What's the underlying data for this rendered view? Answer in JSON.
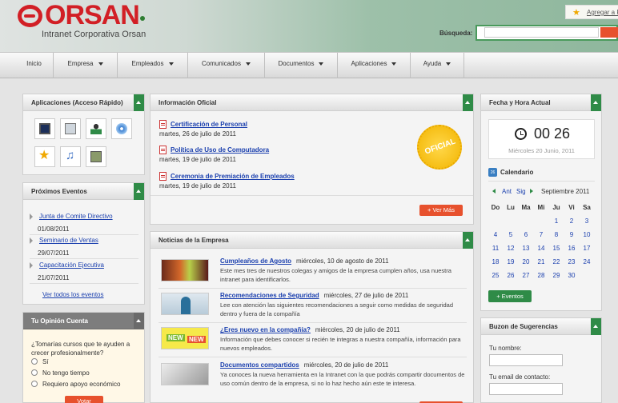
{
  "header": {
    "logo_text": "ORSAN",
    "subtitle": "Intranet Corporativa Orsan",
    "favorites_link": "Agregar a F",
    "search_label": "Búsqueda:",
    "search_value": ""
  },
  "nav": {
    "items": [
      {
        "label": "Inicio",
        "dropdown": false
      },
      {
        "label": "Empresa",
        "dropdown": true
      },
      {
        "label": "Empleados",
        "dropdown": true
      },
      {
        "label": "Comunicados",
        "dropdown": true
      },
      {
        "label": "Documentos",
        "dropdown": true
      },
      {
        "label": "Aplicaciones",
        "dropdown": true
      },
      {
        "label": "Ayuda",
        "dropdown": true
      }
    ]
  },
  "apps": {
    "title": "Aplicaciones (Acceso Rápido)",
    "icons": [
      "monitor-icon",
      "calculator-icon",
      "user-icon",
      "disc-icon",
      "star-icon",
      "music-icon",
      "book-icon"
    ]
  },
  "events": {
    "title": "Próximos Eventos",
    "items": [
      {
        "title": "Junta de Comite Directivo",
        "date": "01/08/2011"
      },
      {
        "title": "Seminario de Ventas",
        "date": "29/07/2011"
      },
      {
        "title": "Capacitación Ejecutiva",
        "date": "21/07/2011"
      }
    ],
    "all_link": "Ver todos los eventos"
  },
  "survey": {
    "title": "Tu Opinión Cuenta",
    "question": "¿Tomarías cursos que te ayuden a crecer profesionalmente?",
    "options": [
      "Sí",
      "No tengo tiempo",
      "Requiero apoyo económico"
    ],
    "button": "Votar"
  },
  "official": {
    "title": "Información Oficial",
    "items": [
      {
        "title": "Certificación de Personal",
        "date": "martes, 26 de julio de 2011"
      },
      {
        "title": "Política de Uso de Computadora",
        "date": "martes, 19 de julio de 2011"
      },
      {
        "title": "Ceremonia de Premiación de Empleados",
        "date": "martes, 19 de julio de 2011"
      }
    ],
    "badge": "OFICIAL",
    "more": "+ Ver Más"
  },
  "news": {
    "title": "Noticias de la Empresa",
    "items": [
      {
        "title": "Cumpleaños de Agosto",
        "date": "miércoles, 10 de agosto de 2011",
        "body": "Este mes tres de nuestros colegas y amigos de la empresa cumplen años, usa nuestra intranet para identificarlos."
      },
      {
        "title": "Recomendaciones de Seguridad",
        "date": "miércoles, 27 de julio de 2011",
        "body": "Lee con atención las siguientes recomendaciones a seguir como medidas de seguridad dentro y fuera de la compañía"
      },
      {
        "title": "¿Eres nuevo en la compañía?",
        "date": "miércoles, 20 de julio de 2011",
        "body": "Información que debes conocer si recién te integras a nuestra compañía, información para nuevos empleados.",
        "thumb_text": "NEW"
      },
      {
        "title": "Documentos compartidos",
        "date": "miércoles, 20 de julio de 2011",
        "body": "Ya conoces la nueva herramienta en la Intranet con la que podrás compartir documentos de uso común dentro de la empresa, si no lo haz hecho aún este te interesa."
      }
    ]
  },
  "datetime": {
    "title": "Fecha y Hora Actual",
    "time": "00 26",
    "date": "Miércoles 20 Junio, 2011"
  },
  "calendar": {
    "label": "Calendario",
    "icon_day": "26",
    "prev": "Ant",
    "next": "Sig",
    "month": "Septiembre 2011",
    "days": [
      "Do",
      "Lu",
      "Ma",
      "Mi",
      "Ju",
      "Vi",
      "Sa"
    ],
    "weeks": [
      [
        "",
        "",
        "",
        "",
        "1",
        "2",
        "3"
      ],
      [
        "4",
        "5",
        "6",
        "7",
        "8",
        "9",
        "10"
      ],
      [
        "11",
        "12",
        "13",
        "14",
        "15",
        "16",
        "17"
      ],
      [
        "18",
        "19",
        "20",
        "21",
        "22",
        "23",
        "24"
      ],
      [
        "25",
        "26",
        "27",
        "28",
        "29",
        "30",
        ""
      ]
    ],
    "events_button": "+ Eventos"
  },
  "suggestions": {
    "title": "Buzon de Sugerencias",
    "name_label": "Tu nombre:",
    "email_label": "Tu email de contacto:"
  },
  "colors": {
    "brand_red": "#d21f25",
    "accent_green": "#2f8b47",
    "button_orange": "#e7512d",
    "link_blue": "#1a3fae"
  }
}
